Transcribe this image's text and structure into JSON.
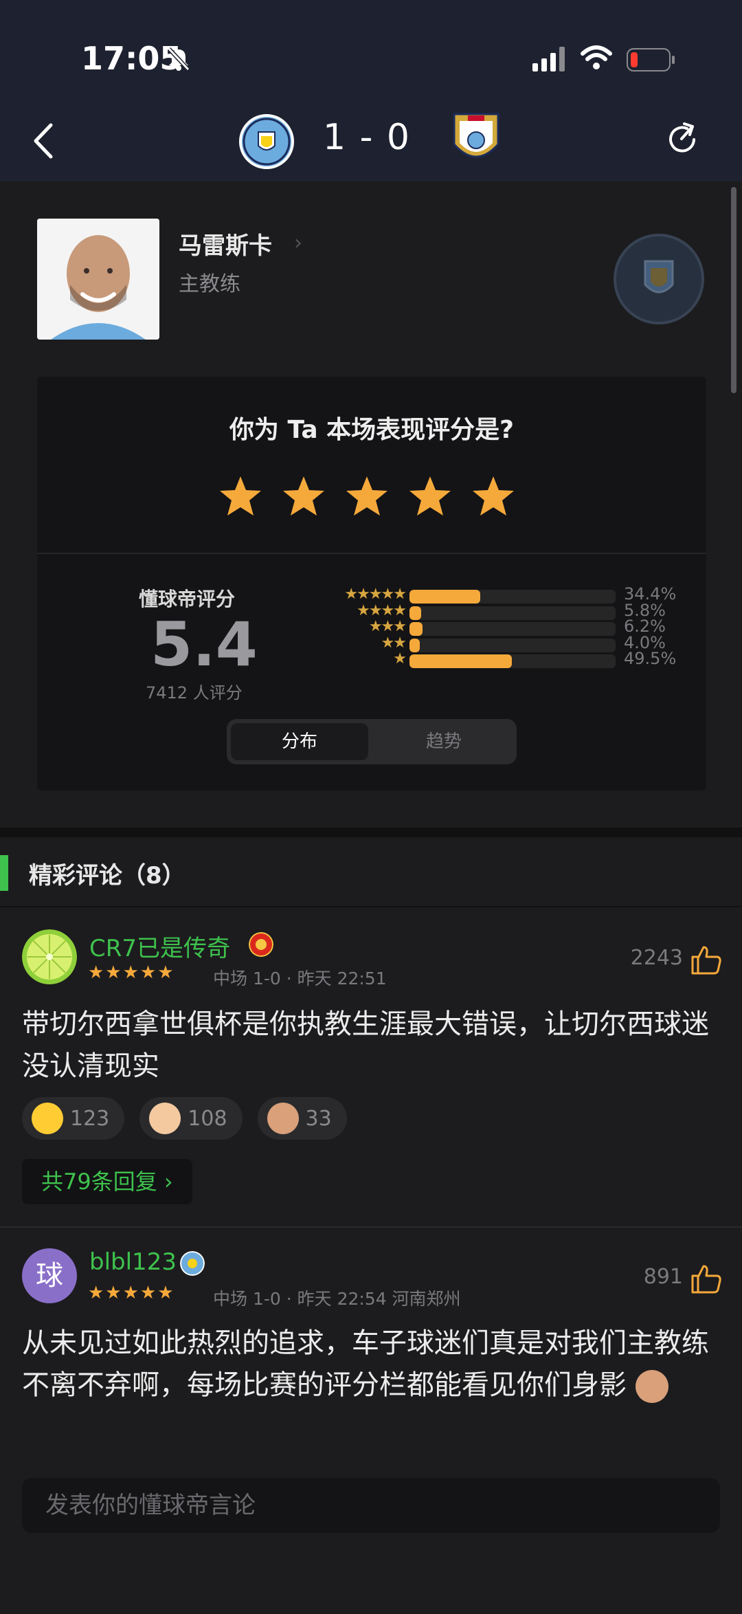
{
  "status_bar": {
    "time": "17:05"
  },
  "match": {
    "score": "1 - 0",
    "home_team_icon": "manchester-city-crest",
    "away_team_icon": "coventry-city-crest"
  },
  "coach": {
    "name": "马雷斯卡",
    "role": "主教练",
    "team_icon": "manchester-city-crest"
  },
  "rating": {
    "question": "你为 Ta 本场表现评分是?",
    "stars_count": 5,
    "label": "懂球帝评分",
    "score": "5.4",
    "count": "7412 人评分",
    "distribution": [
      {
        "stars": 5,
        "pct_label": "34.4%",
        "pct": 34.4
      },
      {
        "stars": 4,
        "pct_label": "5.8%",
        "pct": 5.8
      },
      {
        "stars": 3,
        "pct_label": "6.2%",
        "pct": 6.2
      },
      {
        "stars": 2,
        "pct_label": "4.0%",
        "pct": 4.0
      },
      {
        "stars": 1,
        "pct_label": "49.5%",
        "pct": 49.5
      }
    ],
    "tabs": [
      "分布",
      "趋势"
    ],
    "active_tab": "分布"
  },
  "comments_section": {
    "title": "精彩评论（8）"
  },
  "comments": [
    {
      "username": "CR7已是传奇",
      "team_badge": "manchester-united-badge",
      "stars": "★★★★★",
      "meta": "中场 1-0 · 昨天 22:51",
      "likes": "2243",
      "text": "带切尔西拿世俱杯是你执教生涯最大错误，让切尔西球迷没认清现实",
      "reactions": [
        {
          "icon": "laugh-cry-emoji",
          "count": "123"
        },
        {
          "icon": "thumbs-up-emoji",
          "count": "108"
        },
        {
          "icon": "face-sticker-emoji",
          "count": "33"
        }
      ],
      "replies": "共79条回复 ›"
    },
    {
      "username": "blbl123",
      "avatar_text": "球",
      "team_badge": "manchester-city-badge",
      "stars": "★★★★★",
      "meta": "中场 1-0 · 昨天 22:54 河南郑州",
      "likes": "891",
      "text": "从未见过如此热烈的追求，车子球迷们真是对我们主教练不离不弃啊，每场比赛的评分栏都能看见你们身影"
    }
  ],
  "input": {
    "placeholder": "发表你的懂球帝言论"
  }
}
